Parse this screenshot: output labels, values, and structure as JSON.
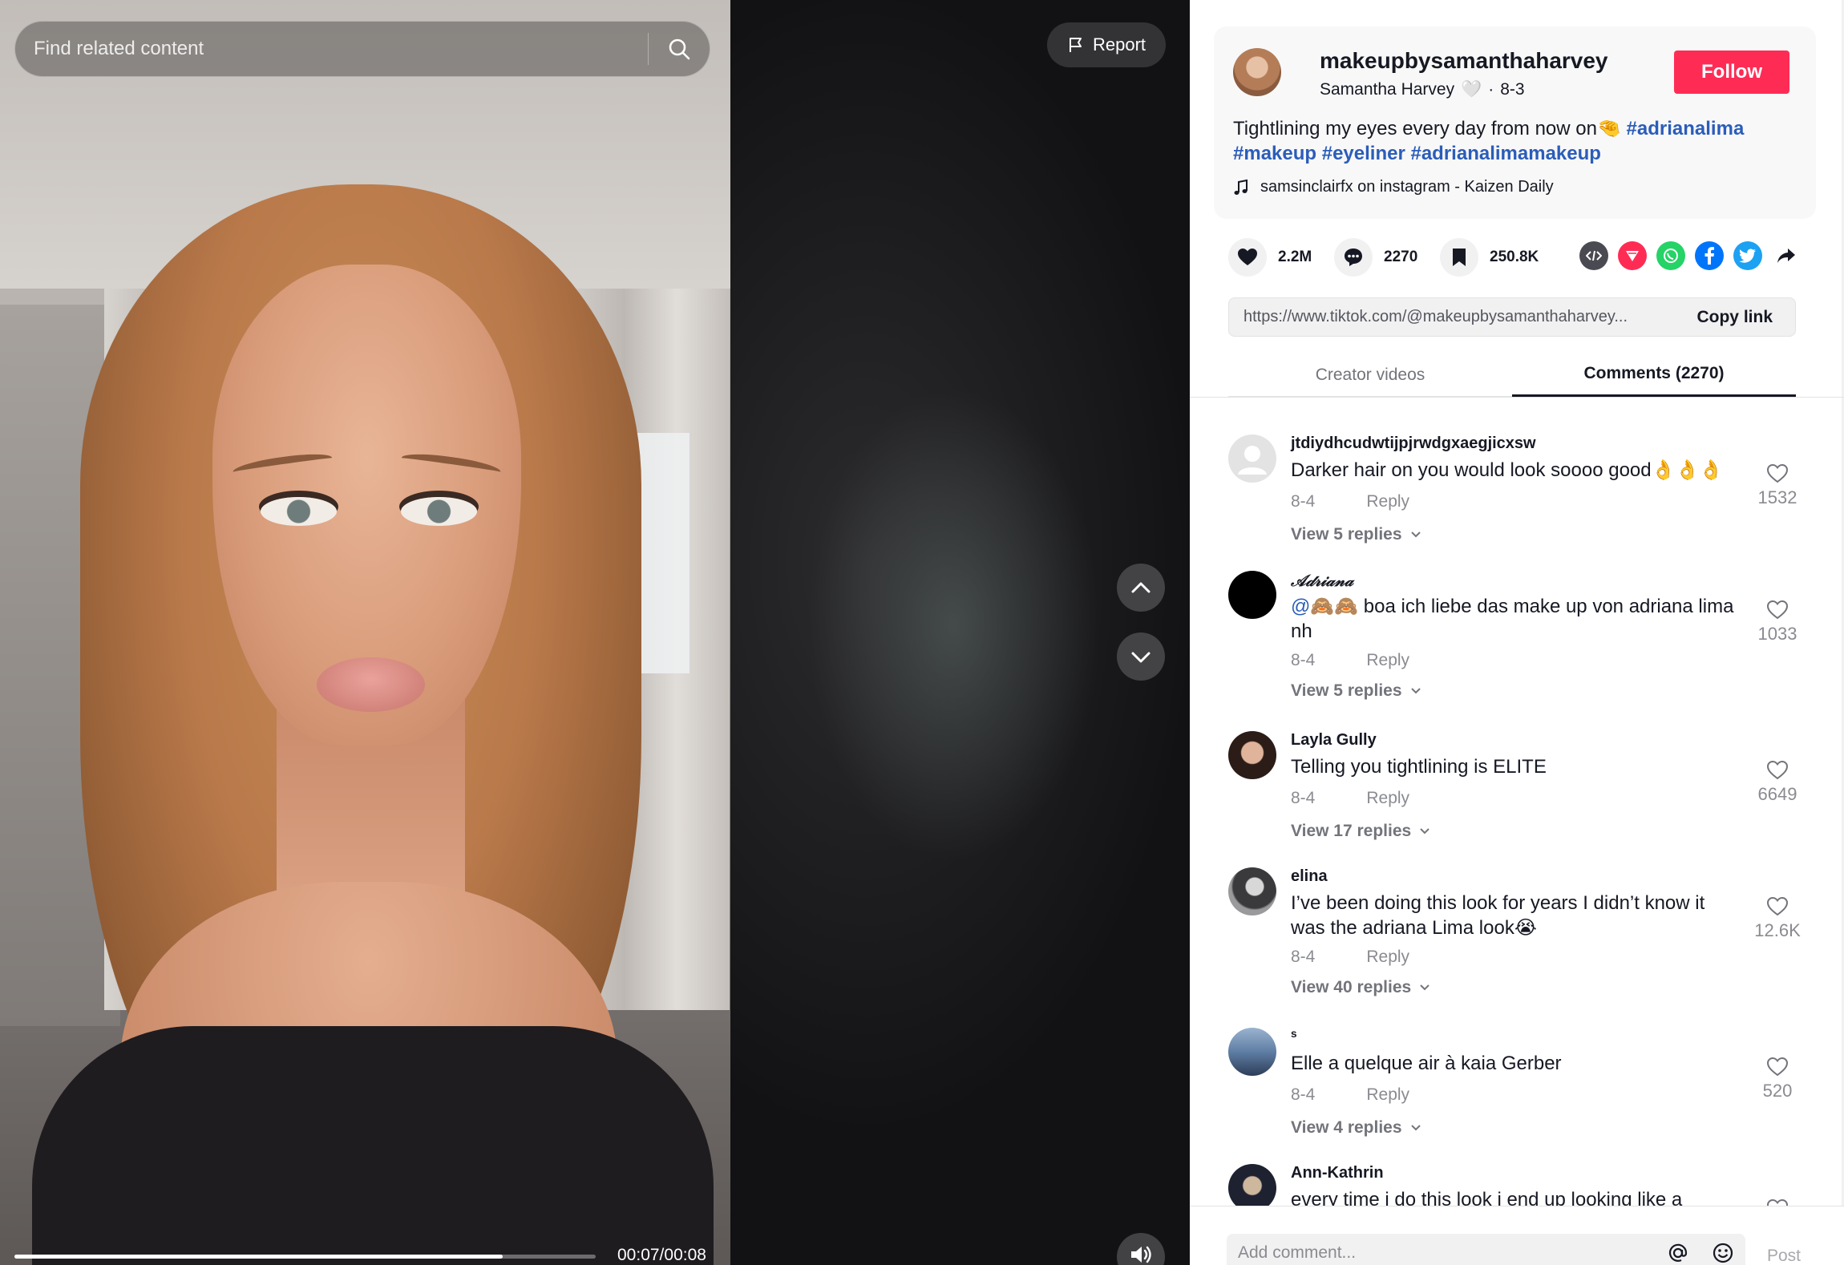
{
  "search": {
    "placeholder": "Find related content"
  },
  "video": {
    "report_label": "Report",
    "time": "00:07/00:08",
    "progress": 0.84
  },
  "creator": {
    "username": "makeupbysamanthaharvey",
    "nickname": "Samantha Harvey",
    "nickname_emoji": "🤍",
    "date": "8-3",
    "follow_label": "Follow"
  },
  "caption": {
    "text": "Tightlining my eyes every day from now on",
    "emoji": "🤏",
    "hashtags": [
      "#adrianalima",
      "#makeup",
      "#eyeliner",
      "#adrianalimamakeup"
    ],
    "music": "samsinclairfx on instagram - Kaizen Daily"
  },
  "actions": {
    "likes": "2.2M",
    "comments": "2270",
    "saves": "250.8K",
    "share_icons": [
      "embed-icon",
      "send-icon",
      "whatsapp-icon",
      "facebook-icon",
      "twitter-icon",
      "share-arrow-icon"
    ]
  },
  "link": {
    "url": "https://www.tiktok.com/@makeupbysamanthaharvey...",
    "copy_label": "Copy link"
  },
  "tabs": {
    "creator_videos": "Creator videos",
    "comments": "Comments (2270)"
  },
  "comments": [
    {
      "name": "jtdiydhcudwtijpjrwdgxaegjicxsw",
      "text": "Darker hair on you would look soooo good👌👌👌",
      "date": "8-4",
      "reply": "Reply",
      "replies": "View 5 replies",
      "likes": "1532"
    },
    {
      "name": "𝒜𝒹𝓇𝒾𝒶𝓃𝒶",
      "mention": "@🙈🙈",
      "text": " boa ich liebe das make up von adriana lima nh",
      "date": "8-4",
      "reply": "Reply",
      "replies": "View 5 replies",
      "likes": "1033"
    },
    {
      "name": "Layla Gully",
      "text": "Telling you tightlining is ELITE",
      "date": "8-4",
      "reply": "Reply",
      "replies": "View 17 replies",
      "likes": "6649"
    },
    {
      "name": "elina",
      "text": "I’ve been doing this look for years I didn’t know it was the adriana Lima look😭",
      "date": "8-4",
      "reply": "Reply",
      "replies": "View 40 replies",
      "likes": "12.6K"
    },
    {
      "name": "ˢ",
      "text": "Elle a quelque air à kaia Gerber",
      "date": "8-4",
      "reply": "Reply",
      "replies": "View 4 replies",
      "likes": "520"
    },
    {
      "name": "Ann-Kathrin",
      "text": "every time i do this look i end up looking like a",
      "date": "",
      "reply": "",
      "replies": "",
      "likes": ""
    }
  ],
  "comment_bar": {
    "placeholder": "Add comment...",
    "post_label": "Post"
  },
  "colors": {
    "follow": "#fe2c55",
    "hashtag": "#2b5db9",
    "send_icon": "#fe2c55",
    "whatsapp": "#25d366",
    "facebook": "#0075fa",
    "twitter": "#1da1f2"
  }
}
